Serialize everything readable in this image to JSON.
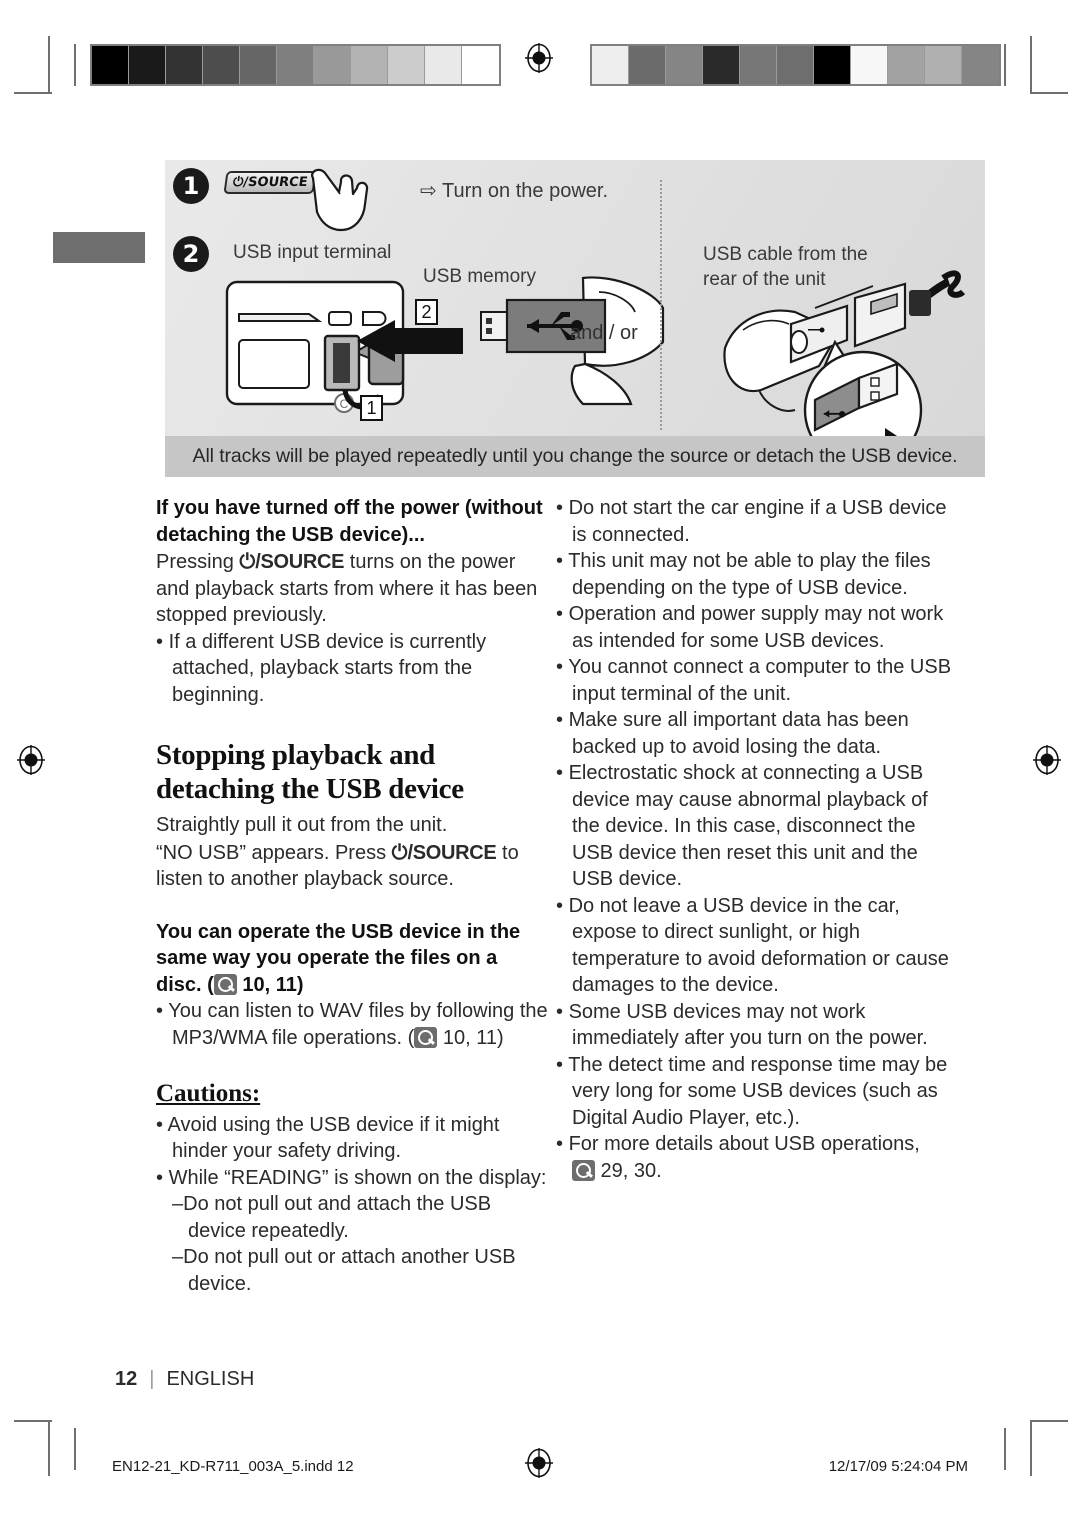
{
  "document": {
    "page_number": "12",
    "language_label": "ENGLISH",
    "folio_separator": "|"
  },
  "illustration": {
    "step1": {
      "number": "1",
      "button_label": "/SOURCE",
      "power_glyph": "⏻",
      "caption_arrow": "⇨",
      "caption": "Turn on the power."
    },
    "step2": {
      "number": "2",
      "label_terminal": "USB input terminal",
      "label_memory": "USB memory",
      "label_cable": "USB cable from the rear of the unit",
      "callout_1": "1",
      "callout_2": "2",
      "connector": "and / or"
    },
    "banner": "All tracks will be played repeatedly until you change the source or detach the USB device."
  },
  "left_column": {
    "heading_1": "If you have turned off the power (without detaching the USB device)...",
    "para_1_pre": "Pressing ",
    "para_1_btn_glyph": "⏻",
    "para_1_btn": "/SOURCE",
    "para_1_post": " turns on the power and playback starts from where it has been stopped previously.",
    "bullet_1": "If a different USB device is currently attached, playback starts from the beginning.",
    "section_heading": "Stopping playback and detaching the USB device",
    "para_2": "Straightly pull it out from the unit.",
    "para_3_pre": "“NO USB” appears. Press ",
    "para_3_btn_glyph": "⏻",
    "para_3_btn": "/SOURCE",
    "para_3_post": " to listen to another playback source.",
    "heading_2_pre": "You can operate the USB device in the same way you operate the files on a disc. (",
    "heading_2_post": " 10, 11)",
    "bullet_2_pre": "You can listen to WAV files by following the MP3/WMA file operations. (",
    "bullet_2_post": " 10, 11)",
    "cautions_heading": "Cautions:",
    "caution_bullets": [
      "Avoid using the USB device if it might hinder your safety driving.",
      "While “READING” is shown on the display:"
    ],
    "caution_subbullets": [
      "Do not pull out and attach the USB device repeatedly.",
      "Do not pull out or attach another USB device."
    ]
  },
  "right_column": {
    "bullets": [
      "Do not start the car engine if a USB device is connected.",
      "This unit may not be able to play the files depending on the type of USB device.",
      "Operation and power supply may not work as intended for some USB devices.",
      "You cannot connect a computer to the USB input terminal of the unit.",
      "Make sure all important data has been backed up to avoid losing the data.",
      "Electrostatic shock at connecting a USB device may cause abnormal playback of the device. In this case, disconnect the USB device then reset this unit and the USB device.",
      "Do not leave a USB device in the car, expose to direct sunlight, or high temperature to avoid deformation or cause damages to the device.",
      "Some USB devices may not work immediately after you turn on the power.",
      "The detect time and response time may be very long for some USB devices (such as Digital Audio Player, etc.)."
    ],
    "last_bullet_pre": "For more details about USB operations,",
    "last_bullet_post": " 29, 30."
  },
  "print_marks": {
    "slug_left": "EN12-21_KD-R711_003A_5.indd   12",
    "slug_right": "12/17/09   5:24:04 PM",
    "colorbar_left": [
      "#000000",
      "#1a1a1a",
      "#333333",
      "#4d4d4d",
      "#666666",
      "#7f7f7f",
      "#999999",
      "#b3b3b3",
      "#cccccc",
      "#e9e9e9",
      "#ffffff"
    ],
    "colorbar_right": [
      "#eeeeee",
      "#6b6b6b",
      "#858585",
      "#2a2a2a",
      "#777777",
      "#6e6e6e",
      "#000000",
      "#f7f7f7",
      "#a2a2a2",
      "#b0b0b0",
      "#858585"
    ]
  }
}
